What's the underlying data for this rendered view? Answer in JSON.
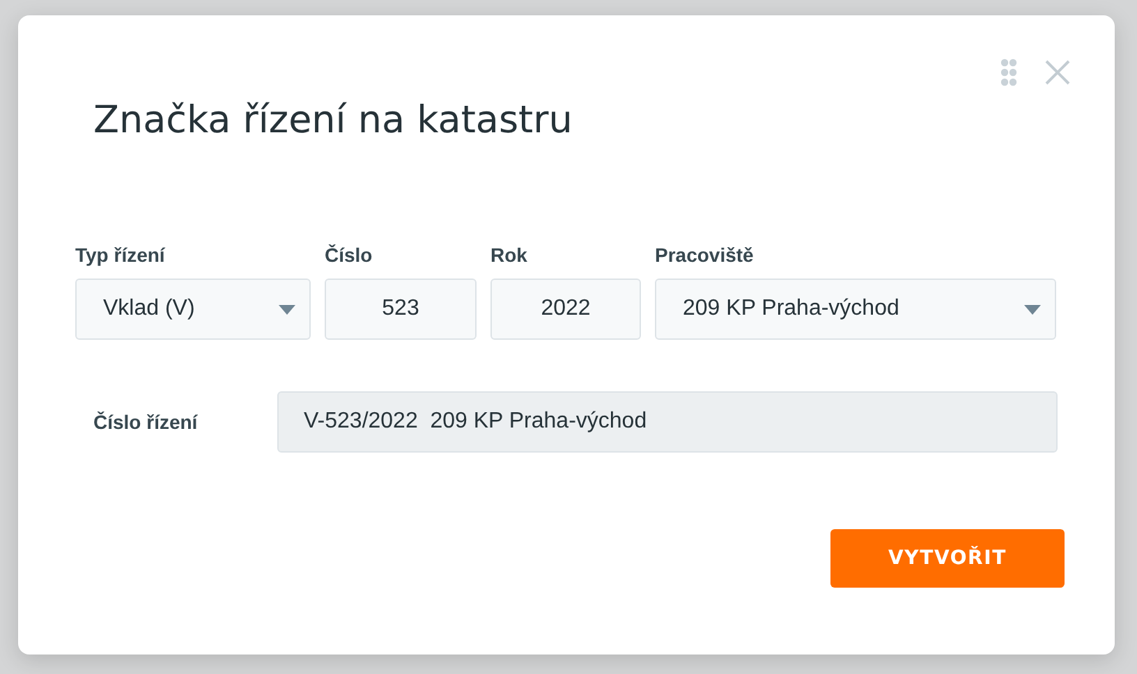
{
  "dialog": {
    "title": "Značka řízení na katastru"
  },
  "fields": [
    {
      "kind": "select",
      "label": "Typ řízení",
      "value": "Vklad (V)"
    },
    {
      "kind": "input",
      "label": "Číslo",
      "value": "523"
    },
    {
      "kind": "input",
      "label": "Rok",
      "value": "2022"
    },
    {
      "kind": "select",
      "label": "Pracoviště",
      "value": "209 KP Praha-východ"
    }
  ],
  "result": {
    "label": "Číslo řízení",
    "value": "V-523/2022  209 KP Praha-východ"
  },
  "buttons": [
    "VYTVOŘIT"
  ]
}
